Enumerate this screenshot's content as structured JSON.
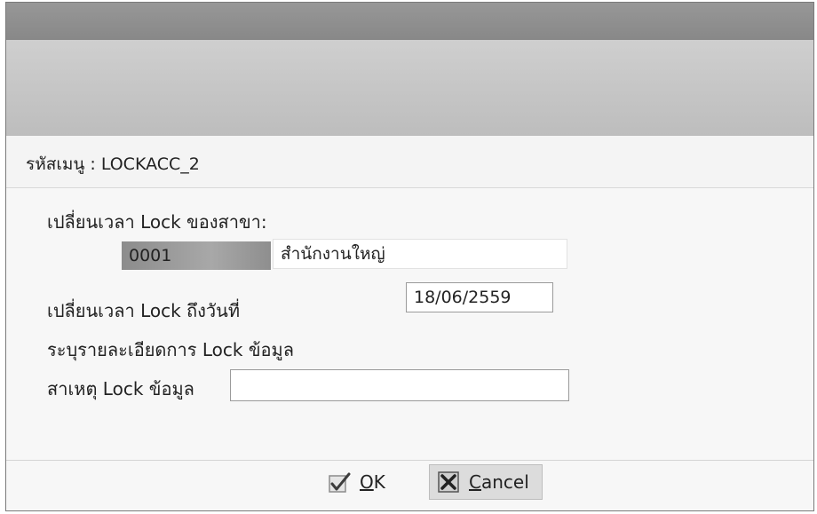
{
  "menu_code": "รหัสเมนู : LOCKACC_2",
  "form": {
    "branch_label": "เปลี่ยนเวลา Lock ของสาขา:",
    "branch_code": "0001",
    "branch_name": "สำนักงานใหญ่",
    "lock_date_label": "เปลี่ยนเวลา Lock ถึงวันที่",
    "lock_date": "18/06/2559",
    "details_label": "ระบุรายละเอียดการ Lock ข้อมูล",
    "reason_label": "สาเหตุ Lock ข้อมูล",
    "reason_value": ""
  },
  "buttons": {
    "ok_mnemonic": "O",
    "ok_rest": "K",
    "cancel_mnemonic": "C",
    "cancel_rest": "ancel"
  },
  "icons": {
    "ok": "check-icon",
    "cancel": "cancel-x-icon"
  }
}
